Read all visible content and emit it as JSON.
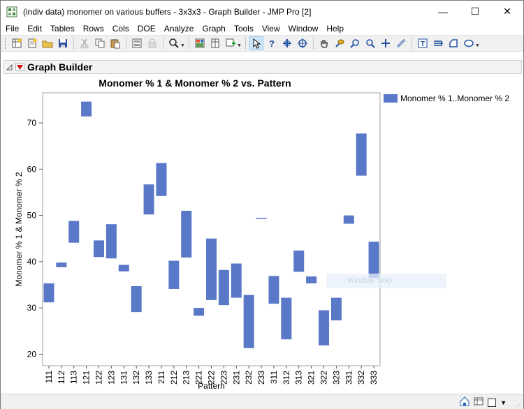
{
  "window": {
    "title": "(indiv data) monomer on various buffers - 3x3x3 - Graph Builder - JMP Pro [2]",
    "minimize": "—",
    "maximize": "☐",
    "close": "✕"
  },
  "menu": [
    "File",
    "Edit",
    "Tables",
    "Rows",
    "Cols",
    "DOE",
    "Analyze",
    "Graph",
    "Tools",
    "View",
    "Window",
    "Help"
  ],
  "toolbar": {
    "icons": [
      "new-data-table-icon",
      "new-script-icon",
      "open-icon",
      "save-icon",
      "cut-icon",
      "copy-icon",
      "paste-icon",
      "data-view-icon",
      "lock-icon",
      "search-icon",
      "layout-icon",
      "column-info-icon",
      "add-rows-icon",
      "arrow-tool-icon",
      "help-tool-icon",
      "selection-tool-icon",
      "crosshair-tool-icon",
      "grabber-tool-icon",
      "lasso-tool-icon",
      "magnifier-tool-icon",
      "brush-tool-icon",
      "plus-tool-icon",
      "line-tool-icon",
      "text-tool-icon",
      "polygon-tool-icon",
      "shape-tool-icon",
      "oval-tool-icon"
    ]
  },
  "outline": {
    "title": "Graph Builder"
  },
  "watermark": "Window Snip",
  "chart_data": {
    "type": "floating-bar",
    "title": "Monomer % 1 & Monomer % 2 vs. Pattern",
    "xlabel": "Pattern",
    "ylabel": "Monomer % 1 & Monomer % 2",
    "ylim": [
      17.5,
      76.5
    ],
    "yticks": [
      20,
      30,
      40,
      50,
      60,
      70
    ],
    "grid": false,
    "legend_position": "right",
    "series": [
      {
        "name": "Monomer % 1..Monomer % 2",
        "color": "#5a78c8"
      }
    ],
    "categories": [
      "111",
      "112",
      "113",
      "121",
      "122",
      "123",
      "131",
      "132",
      "133",
      "211",
      "212",
      "213",
      "221",
      "222",
      "223",
      "231",
      "232",
      "233",
      "311",
      "312",
      "313",
      "321",
      "322",
      "323",
      "331",
      "332",
      "333"
    ],
    "ranges": [
      [
        31.2,
        35.3
      ],
      [
        38.8,
        39.8
      ],
      [
        44.1,
        48.8
      ],
      [
        71.4,
        74.6
      ],
      [
        41.0,
        44.6
      ],
      [
        40.7,
        48.1
      ],
      [
        37.9,
        39.3
      ],
      [
        29.1,
        34.7
      ],
      [
        50.2,
        56.7
      ],
      [
        54.2,
        61.3
      ],
      [
        34.1,
        40.2
      ],
      [
        40.9,
        51.0
      ],
      [
        28.3,
        30.0
      ],
      [
        31.7,
        45.0
      ],
      [
        30.6,
        38.2
      ],
      [
        32.2,
        39.6
      ],
      [
        21.3,
        32.8
      ],
      [
        49.4,
        49.4
      ],
      [
        30.9,
        36.9
      ],
      [
        23.2,
        32.2
      ],
      [
        37.8,
        42.4
      ],
      [
        35.3,
        36.8
      ],
      [
        21.9,
        29.5
      ],
      [
        27.3,
        32.2
      ],
      [
        48.2,
        50.0
      ],
      [
        58.6,
        67.7
      ],
      [
        36.5,
        44.3
      ]
    ]
  }
}
